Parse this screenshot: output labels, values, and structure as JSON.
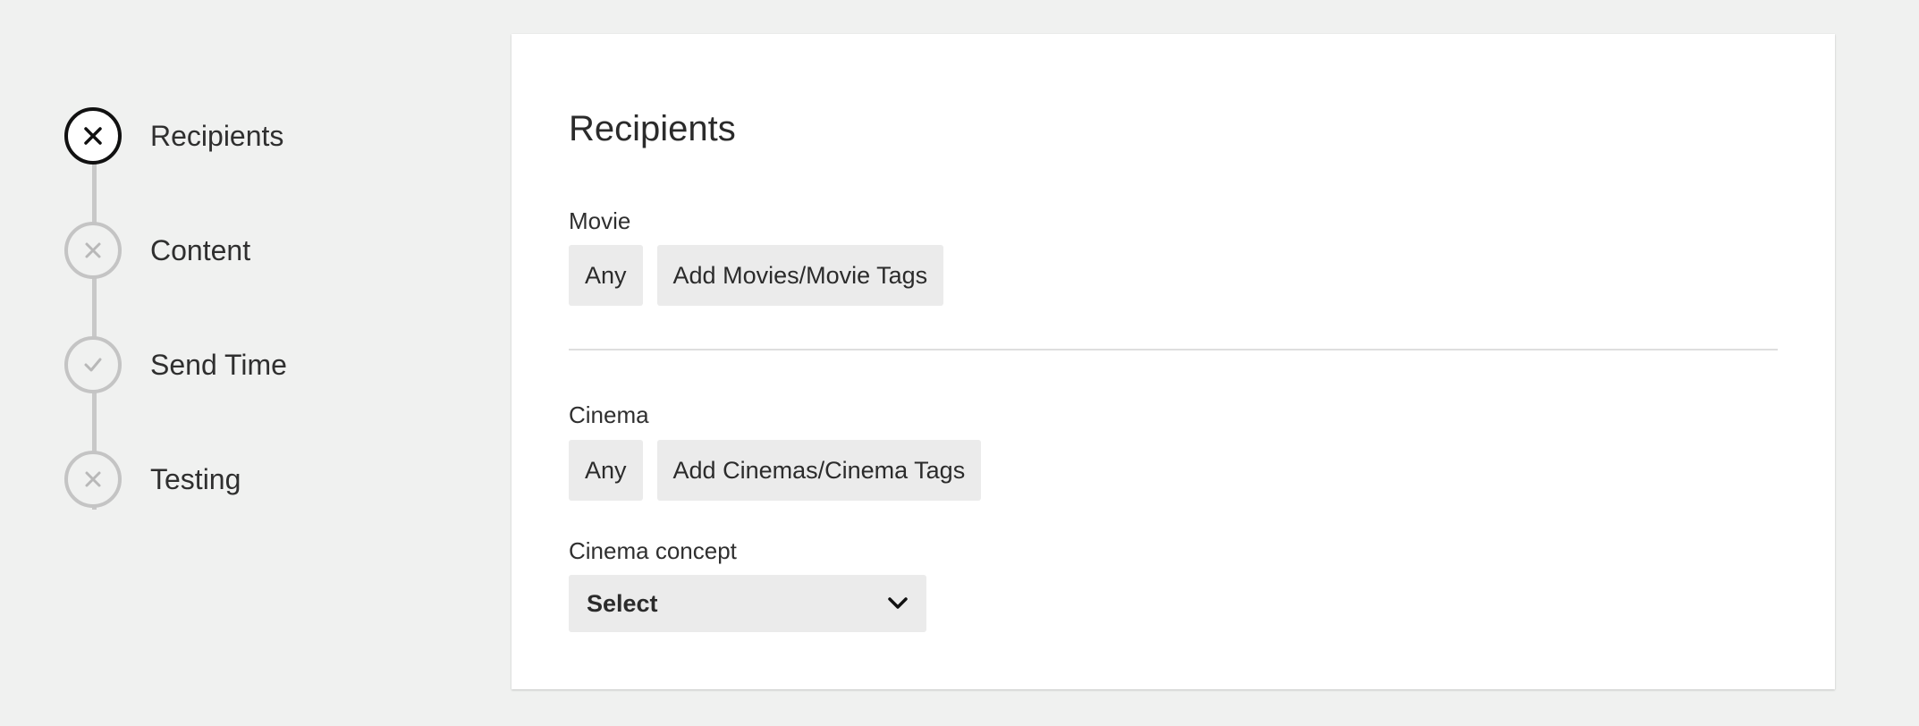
{
  "stepper": {
    "steps": [
      {
        "label": "Recipients",
        "icon": "close-icon",
        "state": "active"
      },
      {
        "label": "Content",
        "icon": "close-icon",
        "state": "incomplete"
      },
      {
        "label": "Send Time",
        "icon": "check-icon",
        "state": "complete"
      },
      {
        "label": "Testing",
        "icon": "close-icon",
        "state": "incomplete"
      }
    ]
  },
  "card": {
    "title": "Recipients",
    "movie": {
      "label": "Movie",
      "any_label": "Any",
      "add_label": "Add Movies/Movie Tags"
    },
    "cinema": {
      "label": "Cinema",
      "any_label": "Any",
      "add_label": "Add Cinemas/Cinema Tags"
    },
    "cinema_concept": {
      "label": "Cinema concept",
      "selected": "Select",
      "icon": "chevron-down-icon"
    }
  },
  "colors": {
    "background": "#f0f1f0",
    "card": "#ffffff",
    "chip": "#ebebeb",
    "active_step": "#111111",
    "inactive_step": "#c4c4c4",
    "text": "#2b2b2b"
  }
}
